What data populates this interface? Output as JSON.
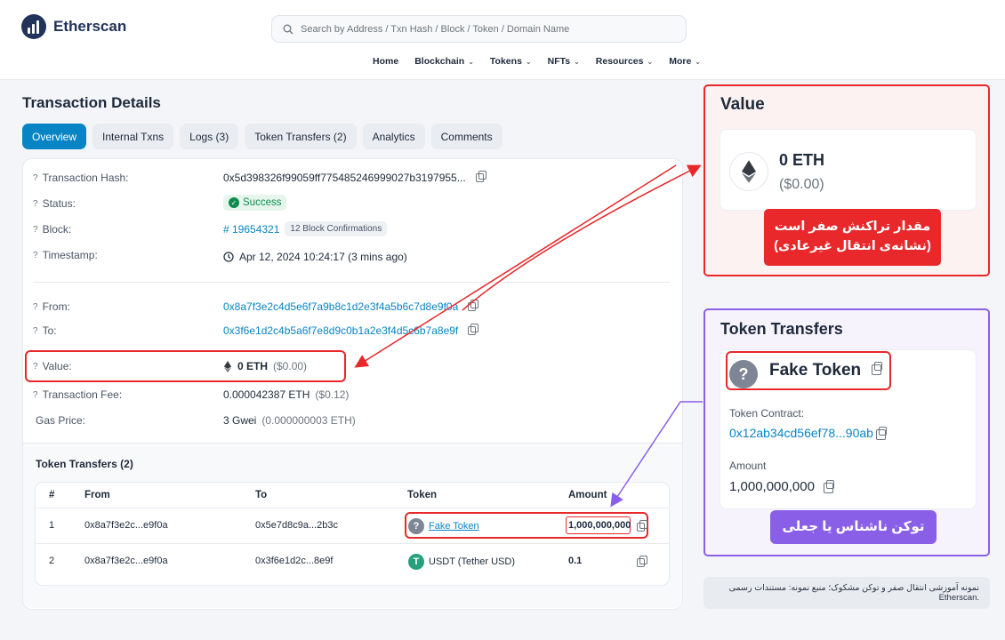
{
  "header": {
    "logo_text": "Etherscan",
    "search_placeholder": "Search by Address / Txn Hash / Block / Token / Domain Name",
    "nav": [
      {
        "label": "Home",
        "dropdown": false
      },
      {
        "label": "Blockchain",
        "dropdown": true
      },
      {
        "label": "Tokens",
        "dropdown": true
      },
      {
        "label": "NFTs",
        "dropdown": true
      },
      {
        "label": "Resources",
        "dropdown": true
      },
      {
        "label": "More",
        "dropdown": true
      }
    ]
  },
  "page_title": "Transaction Details",
  "tabs": [
    "Overview",
    "Internal Txns",
    "Logs (3)",
    "Token Transfers (2)",
    "Analytics",
    "Comments"
  ],
  "details": {
    "tx_hash_label": "Transaction Hash:",
    "tx_hash": "0x5d398326f99059ff775485246999027b3197955...",
    "status_label": "Status:",
    "status": "Success",
    "block_label": "Block:",
    "block": "# 19654321",
    "block_confirmations": "12 Block Confirmations",
    "timestamp_label": "Timestamp:",
    "timestamp": "Apr 12, 2024 10:24:17 (3 mins ago)",
    "from_label": "From:",
    "from": "0x8a7f3e2c4d5e6f7a9b8c1d2e3f4a5b6c7d8e9f0a",
    "to_label": "To:",
    "to": "0x3f6e1d2c4b5a6f7e8d9c0b1a2e3f4d5c6b7a8e9f",
    "value_label": "Value:",
    "value_eth": "0 ETH",
    "value_usd": "($0.00)",
    "fee_label": "Transaction Fee:",
    "fee": "0.000042387 ETH",
    "fee_usd": "($0.12)",
    "gas_label": "Gas Price:",
    "gas": "3 Gwei",
    "gas_eth": "(0.000000003 ETH)"
  },
  "token_transfers": {
    "title": "Token Transfers (2)",
    "columns": [
      "#",
      "From",
      "To",
      "Token",
      "Amount"
    ],
    "rows": [
      {
        "n": "1",
        "from": "0x8a7f3e2c...e9f0a",
        "to": "0x5e7d8c9a...2b3c",
        "token": "Fake Token",
        "amount": "1,000,000,000"
      },
      {
        "n": "2",
        "from": "0x8a7f3e2c...e9f0a",
        "to": "0x3f6e1d2c...8e9f",
        "token": "USDT (Tether USD)",
        "amount": "0.1"
      }
    ]
  },
  "value_panel": {
    "title": "Value",
    "eth": "0 ETH",
    "usd": "($0.00)",
    "note_line1": "مقدار تراکنش صفر است",
    "note_line2": "(نشانه‌ی انتقال غیرعادی)"
  },
  "token_panel": {
    "title": "Token Transfers",
    "token_name": "Fake Token",
    "contract_label": "Token Contract:",
    "contract": "0x12ab34cd56ef78...90ab",
    "amount_label": "Amount",
    "amount": "1,000,000,000",
    "note": "توکن ناشناس یا جعلی"
  },
  "footnote": "نمونه آموزشی انتقال صفر و توکن مشکوک؛ منبع نمونه: مستندات رسمی .Etherscan",
  "colors": {
    "accent": "#0784c3",
    "annotation_red": "#e8282b",
    "annotation_purple": "#8a5fe8",
    "success": "#0f8b4d"
  }
}
